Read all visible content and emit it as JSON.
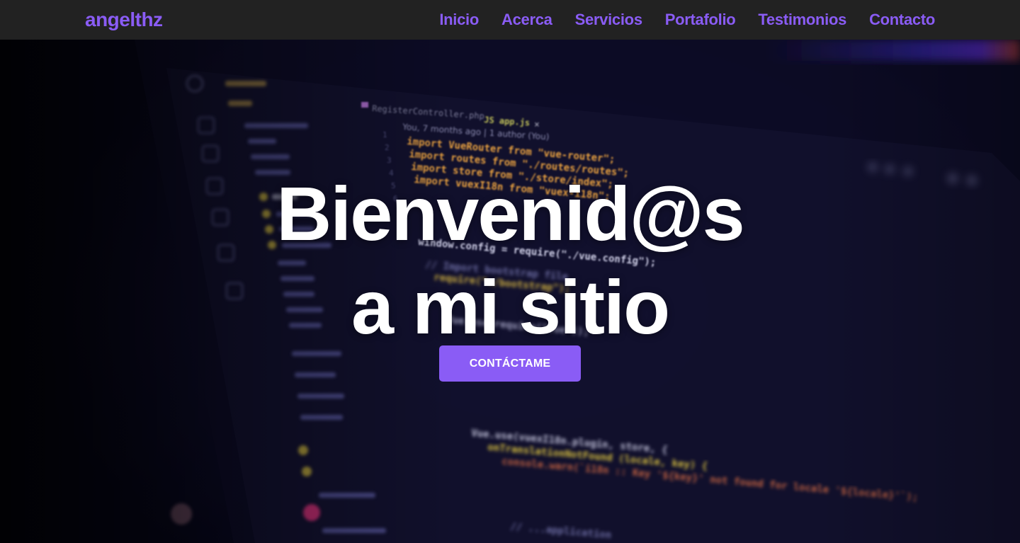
{
  "navbar": {
    "brand": "angelthz",
    "links": [
      "Inicio",
      "Acerca",
      "Servicios",
      "Portafolio",
      "Testimonios",
      "Contacto"
    ]
  },
  "hero": {
    "title_line1": "Bienvenid@s",
    "title_line2": "a mi sitio",
    "cta_label": "CONTÁCTAME",
    "background_code": {
      "tab1": "RegisterController.php",
      "tab2": "JS app.js",
      "blame": "You, 7 months ago | 1 author (You)",
      "lines": [
        "import VueRouter from \"vue-router\";",
        "import routes from \"./routes/routes\";",
        "import store from \"./store/index\";",
        "import vuexI18n from \"vuex-i18n\";",
        "window.config = require(\"./vue.config\");",
        "// Import bootstrap file",
        "require(\"./bootstrap\");",
        "Vue.use(require(\"vue\"));",
        "Vue.use(vuexI18n.plugin, store, {",
        "  onTranslationNotFound (locale, key) {",
        "    console.warn(`i18n :: Key '${key}' not found for locale '${locale}'`);",
        "// ...application"
      ]
    }
  },
  "colors": {
    "accent": "#8a5cf5",
    "navbar_bg": "#222222",
    "title": "#ffffff"
  }
}
